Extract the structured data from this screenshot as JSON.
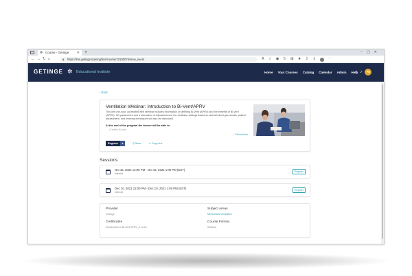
{
  "browser": {
    "tab_title": "Course - Getinge",
    "url": "https://lms.getinge.training/lms/course/10100074/view_event"
  },
  "site": {
    "brand": "GETINGE",
    "subtitle": "Educational Institute",
    "nav": [
      "Home",
      "Your Courses",
      "Catalog",
      "Calendar",
      "Admin",
      "Help"
    ],
    "user_initials": "PB"
  },
  "page": {
    "back_label": "‹ Back"
  },
  "course": {
    "title": "Ventilation Webinar: Introduction to Bi-Vent/APRV",
    "description": "This live one-hour, accredited web seminar includes information on defining Bi-Vent (APRV) and the benefits of Bi-Vent (APRV). Set parameters and a discussion of adjustments to the ventilator settings based on arterial blood gas results, patient assessment, and weaning techniques will also be discussed.",
    "objectives_heading": "At the end of the program the learner will be able to:",
    "objective_1": "• Define Bi-Vent",
    "show_more": "⌄ Show More",
    "register_label": "Register",
    "save_label": "Save",
    "copy_link_label": "Copy link"
  },
  "sessions": {
    "heading": "Sessions",
    "items": [
      {
        "datetime": "Oct 15, 2021 12:00 PM - Oct 15, 2021 1:00 PM (EST)",
        "location": "Internet",
        "button": "Register"
      },
      {
        "datetime": "Dec 10, 2021 12:00 PM - Dec 10, 2021 1:00 PM (EST)",
        "location": "Internet",
        "button": "Register"
      }
    ]
  },
  "info": {
    "provider_label": "Provider",
    "provider_value": "Getinge",
    "certificates_label": "Certificates",
    "certificates_value": "Introduction to Bi-Vent APRV_9.14.21",
    "subject_label": "Subject Areas",
    "subject_value": "Mechanical Ventilation",
    "format_label": "Course Format",
    "format_value": "Webinar"
  },
  "colors": {
    "header_navy": "#1e2a4a",
    "accent_teal": "#2aa0b2",
    "avatar_gold": "#e0a72c"
  }
}
